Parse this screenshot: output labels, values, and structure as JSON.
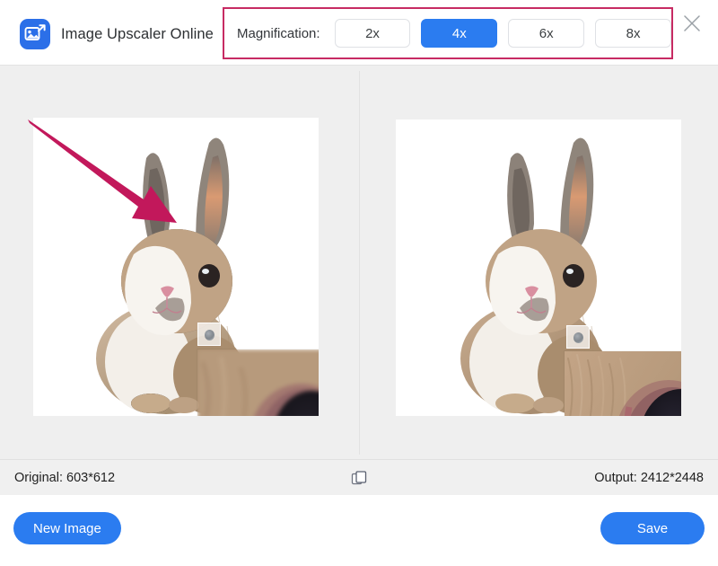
{
  "header": {
    "logo_icon": "image-upscale-icon",
    "title": "Image Upscaler Online",
    "close_icon": "close-icon",
    "magnification": {
      "label": "Magnification:",
      "selected": "4x",
      "options": [
        {
          "label": "2x",
          "selected": false
        },
        {
          "label": "4x",
          "selected": true
        },
        {
          "label": "6x",
          "selected": false
        },
        {
          "label": "8x",
          "selected": false
        }
      ]
    }
  },
  "preview": {
    "left": {
      "name": "original-preview",
      "subject": "rabbit-photo",
      "loupe": "magnifier-selection-box",
      "detail": "original-detail-blurry"
    },
    "right": {
      "name": "upscaled-preview",
      "subject": "rabbit-photo",
      "loupe": "magnifier-selection-box",
      "detail": "upscaled-detail-sharp"
    }
  },
  "annotation": {
    "arrow_icon": "pointer-arrow-icon",
    "arrow_color": "#c2185b"
  },
  "statusbar": {
    "original_label": "Original: 603*612",
    "output_label": "Output: 2412*2448",
    "compare_icon": "compare-copy-icon"
  },
  "footer": {
    "new_image_label": "New Image",
    "save_label": "Save"
  },
  "colors": {
    "accent_blue": "#2b7cf0",
    "highlight_pink": "#c72b63",
    "canvas_bg": "#efefef",
    "statusbar_bg": "#f0f0f0"
  }
}
